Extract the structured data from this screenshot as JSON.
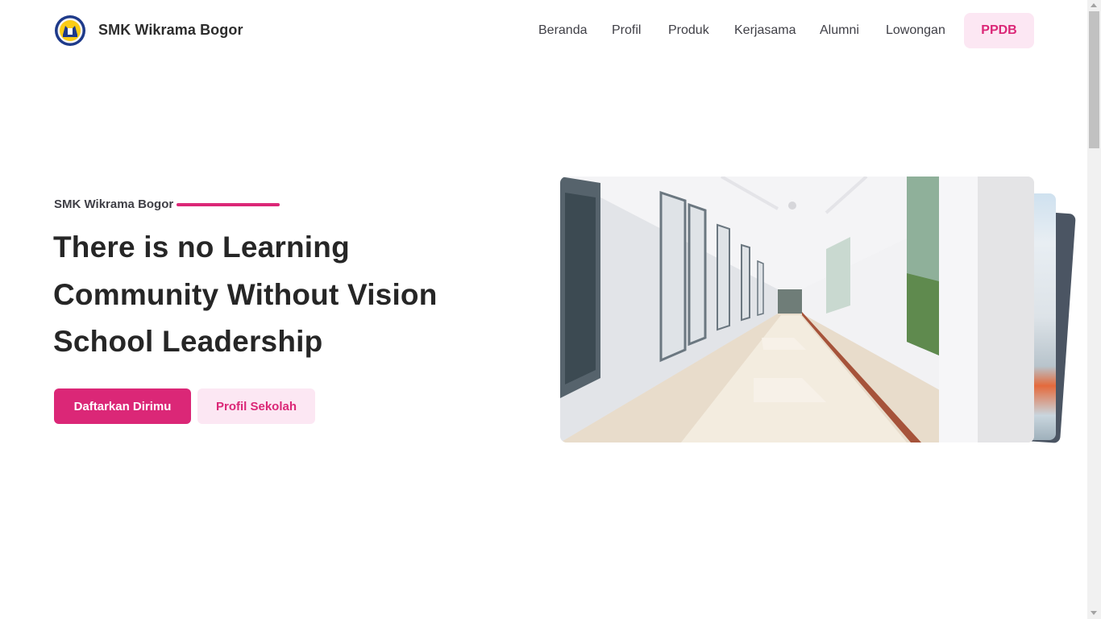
{
  "header": {
    "brand_name": "SMK Wikrama Bogor",
    "logo_icon": "school-crest-logo",
    "nav": [
      {
        "label": "Beranda"
      },
      {
        "label": "Profil"
      },
      {
        "label": "Produk"
      },
      {
        "label": "Kerjasama"
      },
      {
        "label": "Alumni"
      },
      {
        "label": "Lowongan"
      }
    ],
    "cta_label": "PPDB"
  },
  "hero": {
    "eyebrow": "SMK Wikrama Bogor",
    "headline_lines": [
      "There is no Learning",
      "Community Without Vision",
      "School Leadership"
    ],
    "primary_button": "Daftarkan Dirimu",
    "secondary_button": "Profil Sekolah",
    "image_subject": "school-corridor-photo"
  },
  "colors": {
    "accent": "#db2777",
    "accent_soft": "#fce7f3",
    "text_dark": "#262626"
  }
}
